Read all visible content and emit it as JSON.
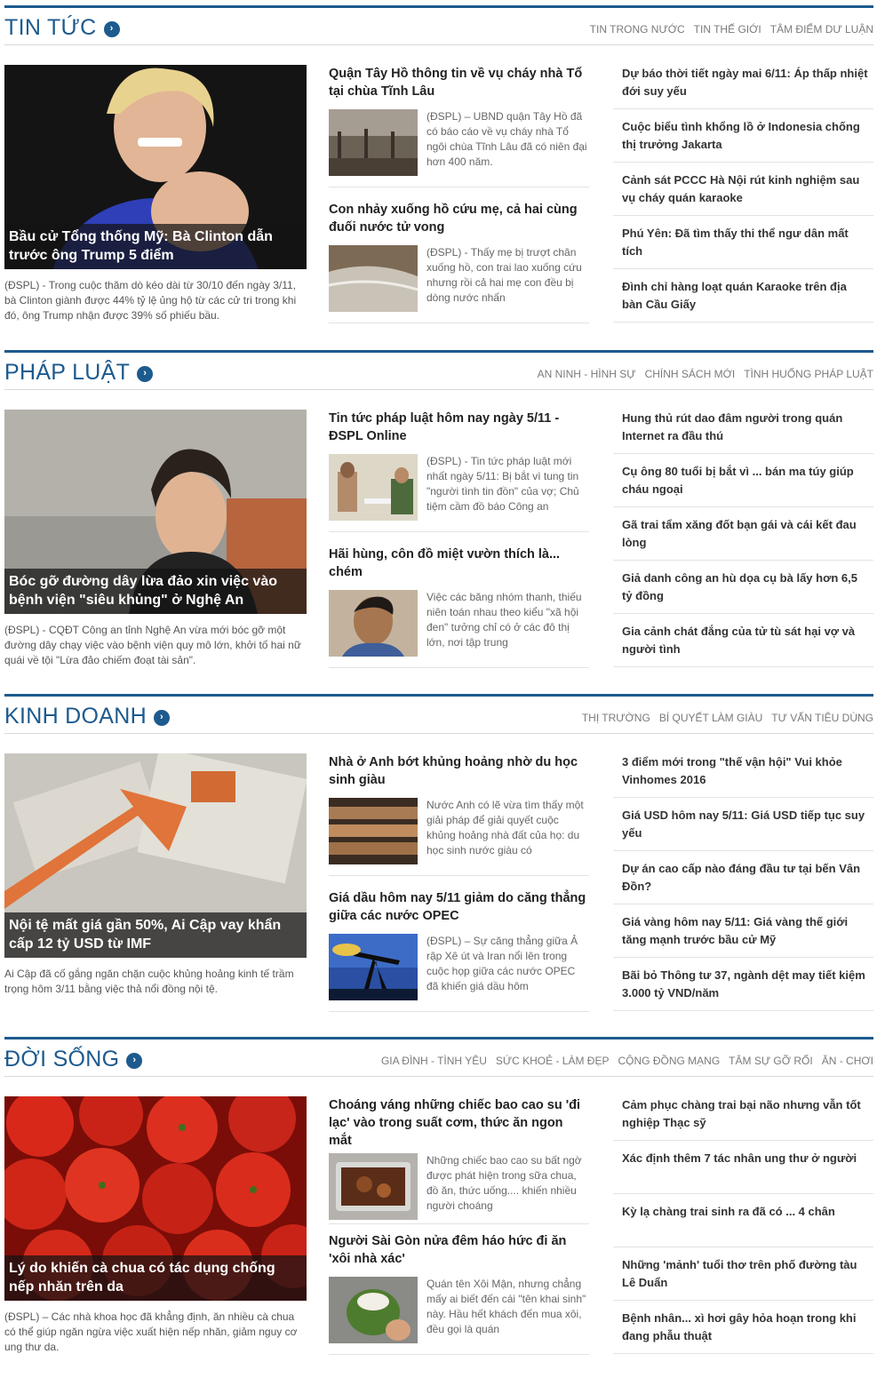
{
  "sections": [
    {
      "title": "TIN TỨC",
      "subnav": [
        "TIN TRONG NƯỚC",
        "TIN THẾ GIỚI",
        "TÂM ĐIỂM DƯ LUẬN"
      ],
      "featured": {
        "caption": "Bầu cử Tổng thống Mỹ: Bà Clinton dẫn trước ông Trump 5 điểm",
        "desc": "(ĐSPL) - Trong cuộc thăm dò kéo dài từ 30/10 đến ngày 3/11, bà Clinton giành được 44% tỷ lệ ủng hộ từ các cử tri trong khi đó, ông Trump nhận được 39% số phiếu bầu."
      },
      "stories": [
        {
          "title": "Quận Tây Hồ thông tin về vụ cháy nhà Tổ tại chùa Tĩnh Lâu",
          "text": "(ĐSPL) – UBND quận Tây Hồ đã có báo cáo về vụ cháy nhà Tổ ngôi chùa Tĩnh Lâu đã có niên đại hơn 400 năm."
        },
        {
          "title": "Con nhảy xuống hồ cứu mẹ, cả hai cùng đuối nước tử vong",
          "text": "(ĐSPL) - Thấy mẹ bị trượt chân xuống hồ, con trai lao xuống cứu nhưng rồi cả hai mẹ con đều bị dòng nước nhấn"
        }
      ],
      "links": [
        "Dự báo thời tiết ngày mai 6/11: Áp thấp nhiệt đới suy yếu",
        "Cuộc biểu tình khổng lồ ở Indonesia chống thị trưởng Jakarta",
        "Cảnh sát PCCC Hà Nội rút kinh nghiệm sau vụ cháy quán karaoke",
        "Phú Yên: Đã tìm thấy thi thể ngư dân mất tích",
        "Đình chỉ hàng loạt quán Karaoke trên địa bàn Cầu Giấy"
      ]
    },
    {
      "title": "PHÁP LUẬT",
      "subnav": [
        "AN NINH - HÌNH SỰ",
        "CHÍNH SÁCH MỚI",
        "TÌNH HUỐNG PHÁP LUẬT"
      ],
      "featured": {
        "caption": "Bóc gỡ đường dây lừa đảo xin việc vào bệnh viện \"siêu khủng\" ở Nghệ An",
        "desc": "(ĐSPL) - CQĐT Công an tỉnh Nghệ An vừa mới bóc gỡ một đường dây chạy việc vào bệnh viện quy mô lớn, khởi tố hai nữ quái về tội \"Lừa đảo chiếm đoạt tài sản\"."
      },
      "stories": [
        {
          "title": "Tin tức pháp luật hôm nay ngày 5/11 - ĐSPL Online",
          "text": "(ĐSPL) - Tin tức pháp luật mới nhất ngày 5/11: Bị bắt vì tung tin \"người tình tin đồn\" của vợ; Chủ tiệm cầm đồ báo Công an"
        },
        {
          "title": "Hãi hùng, côn đồ miệt vườn thích là... chém",
          "text": "Việc các băng nhóm thanh, thiếu niên toán nhau theo kiểu \"xã hội đen\" tưởng chỉ có ở các đô thị lớn, nơi tập trung"
        }
      ],
      "links": [
        "Hung thủ rút dao đâm người trong quán Internet ra đầu thú",
        "Cụ ông 80 tuổi bị bắt vì ... bán ma túy giúp cháu ngoại",
        "Gã trai tẩm xăng đốt bạn gái và cái kết đau lòng",
        "Giả danh công an hù dọa cụ bà lấy hơn 6,5 tỷ đồng",
        "Gia cảnh chát đắng của tử tù sát hại vợ và người tình"
      ]
    },
    {
      "title": "KINH DOANH",
      "subnav": [
        "THỊ TRƯỜNG",
        "BÍ QUYẾT LÀM GIÀU",
        "TƯ VẤN TIÊU DÙNG"
      ],
      "featured": {
        "caption": "Nội tệ mất giá gần 50%, Ai Cập vay khẩn cấp 12 tỷ USD từ IMF",
        "desc": "Ai Cập đã cố gắng ngăn chặn cuộc khủng hoảng kinh tế trầm trọng hôm 3/11 bằng việc thả nổi đồng nội tệ."
      },
      "stories": [
        {
          "title": "Nhà ở Anh bớt khủng hoảng nhờ du học sinh giàu",
          "text": "Nước Anh có lẽ vừa tìm thấy một giải pháp để giải quyết cuộc khủng hoảng nhà đất của họ: du học sinh nước giàu có"
        },
        {
          "title": "Giá dầu hôm nay 5/11 giảm do căng thẳng giữa các nước OPEC",
          "text": "(ĐSPL) – Sự căng thẳng giữa Ả rập Xê út và Iran nổi lên trong cuộc họp giữa các nước OPEC đã khiến giá dầu hôm"
        }
      ],
      "links": [
        "3 điểm mới trong \"thế vận hội\" Vui khỏe Vinhomes 2016",
        "Giá USD hôm nay 5/11: Giá USD tiếp tục suy yếu",
        "Dự án cao cấp nào đáng đầu tư tại bến Vân Đồn?",
        "Giá vàng hôm nay 5/11: Giá vàng thế giới tăng mạnh trước bầu cử Mỹ",
        "Bãi bỏ Thông tư 37, ngành dệt may tiết kiệm 3.000 tỷ VND/năm"
      ]
    },
    {
      "title": "ĐỜI SỐNG",
      "subnav": [
        "GIA ĐÌNH - TÌNH YÊU",
        "SỨC KHOẺ - LÀM ĐẸP",
        "CỘNG ĐỒNG MẠNG",
        "TÂM SỰ GỠ RỐI",
        "ĂN - CHƠI"
      ],
      "featured": {
        "caption": "Lý do khiến cà chua có tác dụng chống nếp nhăn trên da",
        "desc": "(ĐSPL) – Các nhà khoa học đã khẳng định, ăn nhiều cà chua có thể giúp ngăn ngừa việc xuất hiện nếp nhăn, giảm nguy cơ ung thư da."
      },
      "stories": [
        {
          "title": "Choáng váng những chiếc bao cao su 'đi lạc' vào trong suất cơm, thức ăn ngon mắt",
          "text": "Những chiếc bao cao su bất ngờ được phát hiện trong sữa chua, đồ ăn, thức uống.... khiến nhiều người choáng"
        },
        {
          "title": "Người Sài Gòn nửa đêm háo hức đi ăn 'xôi nhà xác'",
          "text": "Quán tên Xôi Mận, nhưng chẳng mấy ai biết đến cái \"tên khai sinh\" này. Hầu hết khách đến mua xôi, đều gọi là quán"
        }
      ],
      "links": [
        "Cảm phục chàng trai bại não nhưng vẫn tốt nghiệp Thạc sỹ",
        "Xác định thêm 7 tác nhân ung thư ở người",
        "Kỳ lạ chàng trai sinh ra đã có ... 4 chân",
        "Những 'mảnh' tuổi thơ trên phố đường tàu Lê Duẩn",
        "Bệnh nhân... xì hơi gây hỏa hoạn trong khi đang phẫu thuật"
      ]
    }
  ],
  "icons": {
    "section_arrow": "chevron-right-circle-icon"
  },
  "colors": {
    "accent": "#1d5a8e",
    "subnav": "#7a7a7a",
    "divider": "#e3e3e3"
  }
}
